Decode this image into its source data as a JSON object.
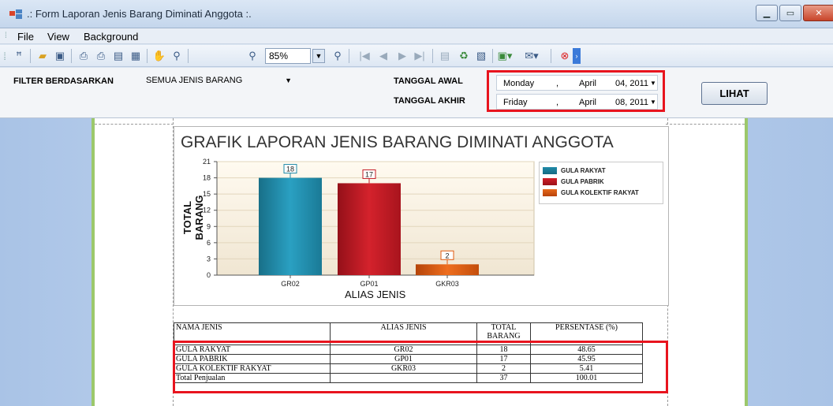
{
  "window": {
    "title": ".: Form Laporan Jenis Barang Diminati Anggota :.",
    "controls": [
      "minimize",
      "maximize",
      "close"
    ]
  },
  "menu": {
    "items": [
      {
        "label": "File"
      },
      {
        "label": "View"
      },
      {
        "label": "Background"
      }
    ]
  },
  "toolbar": {
    "zoom": "85%"
  },
  "filter": {
    "filter_label": "FILTER BERDASARKAN",
    "jenis_value": "SEMUA JENIS BARANG",
    "tanggal_awal_label": "TANGGAL AWAL",
    "tanggal_akhir_label": "TANGGAL AKHIR",
    "awal": {
      "day": "Monday",
      "sep": ",",
      "month": "April",
      "date": "04, 2011"
    },
    "akhir": {
      "day": "Friday",
      "sep": ",",
      "month": "April",
      "date": "08, 2011"
    },
    "lihat_label": "LIHAT"
  },
  "chart_data": {
    "type": "bar",
    "title": "GRAFIK LAPORAN JENIS BARANG DIMINATI ANGGOTA",
    "xlabel": "ALIAS JENIS",
    "ylabel": "TOTAL BARANG",
    "categories": [
      "GR02",
      "GP01",
      "GKR03"
    ],
    "values": [
      18,
      17,
      2
    ],
    "ylim": [
      0,
      21
    ],
    "yticks": [
      0,
      3,
      6,
      9,
      12,
      15,
      18,
      21
    ],
    "legend_position": "right",
    "series": [
      {
        "name": "GULA RAKYAT",
        "color": "#1f8aa8"
      },
      {
        "name": "GULA PABRIK",
        "color": "#c41a24"
      },
      {
        "name": "GULA KOLEKTIF RAKYAT",
        "color": "#e05a10"
      }
    ]
  },
  "table": {
    "headers": [
      "NAMA JENIS",
      "ALIAS JENIS",
      "TOTAL BARANG",
      "PERSENTASE (%)"
    ],
    "rows": [
      [
        "GULA RAKYAT",
        "GR02",
        "18",
        "48.65"
      ],
      [
        "GULA PABRIK",
        "GP01",
        "17",
        "45.95"
      ],
      [
        "GULA KOLEKTIF RAKYAT",
        "GKR03",
        "2",
        "5.41"
      ]
    ],
    "total": [
      "Total Penjualan",
      "",
      "37",
      "100.01"
    ]
  },
  "colors": {
    "highlight": "#e8141e",
    "accent_green": "#9cc86b"
  }
}
